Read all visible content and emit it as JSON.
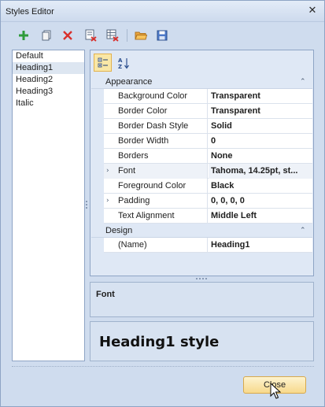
{
  "window": {
    "title": "Styles Editor",
    "close_glyph": "✕"
  },
  "toolbar": {
    "buttons": [
      {
        "name": "add-style-button",
        "icon": "plus-icon"
      },
      {
        "name": "copy-style-button",
        "icon": "copy-icon"
      },
      {
        "name": "delete-style-button",
        "icon": "delete-icon"
      },
      {
        "name": "remove-unused-button",
        "icon": "list-delete-icon"
      },
      {
        "name": "clear-all-button",
        "icon": "grid-delete-icon"
      },
      {
        "name": "open-button",
        "icon": "folder-open-icon"
      },
      {
        "name": "save-button",
        "icon": "save-icon"
      }
    ]
  },
  "styles_list": {
    "items": [
      "Default",
      "Heading1",
      "Heading2",
      "Heading3",
      "Italic"
    ],
    "selected": "Heading1"
  },
  "property_grid": {
    "toolbar": {
      "categorized_icon": "categorized-icon",
      "alphabetical_icon": "sort-az-icon"
    },
    "categories": [
      {
        "name": "Appearance",
        "chevron": "⌃",
        "properties": [
          {
            "name": "Background Color",
            "value": "Transparent",
            "expandable": false
          },
          {
            "name": "Border Color",
            "value": "Transparent",
            "expandable": false
          },
          {
            "name": "Border Dash Style",
            "value": "Solid",
            "expandable": false
          },
          {
            "name": "Border Width",
            "value": "0",
            "expandable": false
          },
          {
            "name": "Borders",
            "value": "None",
            "expandable": false
          },
          {
            "name": "Font",
            "value": "Tahoma, 14.25pt, st...",
            "expandable": true
          },
          {
            "name": "Foreground Color",
            "value": "Black",
            "expandable": false
          },
          {
            "name": "Padding",
            "value": "0, 0, 0, 0",
            "expandable": true
          },
          {
            "name": "Text Alignment",
            "value": "Middle Left",
            "expandable": false
          }
        ]
      },
      {
        "name": "Design",
        "chevron": "⌃",
        "properties": [
          {
            "name": "(Name)",
            "value": "Heading1",
            "expandable": false
          }
        ]
      }
    ],
    "expander_glyph": "›"
  },
  "description": {
    "title": "Font"
  },
  "preview": {
    "text": "Heading1 style"
  },
  "footer": {
    "close_label": "Close"
  }
}
